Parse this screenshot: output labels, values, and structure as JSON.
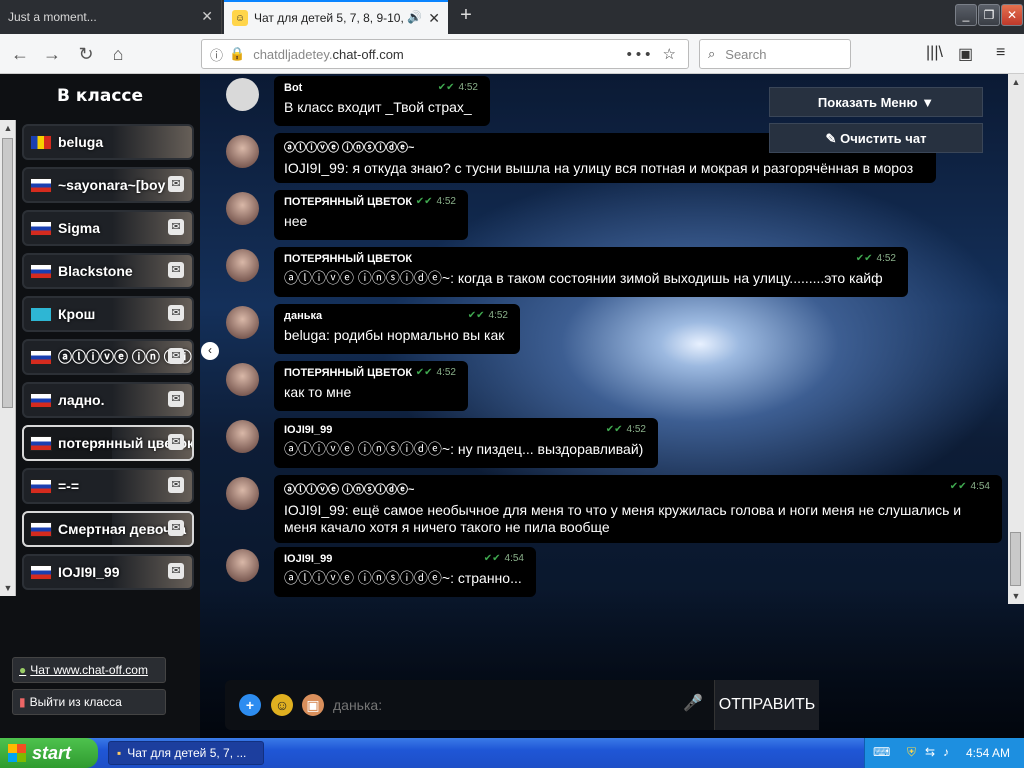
{
  "tabs": [
    {
      "title": "Just a moment..."
    },
    {
      "title": "Чат для детей 5, 7, 8, 9-10,"
    }
  ],
  "navbar": {
    "url_domain_muted": "chatdljadetey.",
    "url_domain_main": "chat-off.com",
    "search_placeholder": "Search",
    "page_actions": "•••"
  },
  "sidebar": {
    "title": "В классе",
    "users": [
      {
        "name": "beluga",
        "flag": "ro",
        "pm": false
      },
      {
        "name": "~sayonara~[boy",
        "flag": "ru",
        "pm": true
      },
      {
        "name": "Sigma",
        "flag": "ru",
        "pm": true
      },
      {
        "name": "Blackstone",
        "flag": "ru",
        "pm": true
      },
      {
        "name": "Крош",
        "flag": "kz",
        "pm": true
      },
      {
        "name": "ⓐⓛⓘⓥⓔ ⓘⓝ ⓢⓘ",
        "flag": "ru",
        "pm": true
      },
      {
        "name": "ладно.",
        "flag": "ru",
        "pm": true
      },
      {
        "name": "потерянный цветок",
        "flag": "ru",
        "pm": true
      },
      {
        "name": "=-=",
        "flag": "ru",
        "pm": true
      },
      {
        "name": "Смертная девочка",
        "flag": "ru",
        "pm": true
      },
      {
        "name": "IOJI9I_99",
        "flag": "ru",
        "pm": true
      }
    ],
    "link_chat": "Чат www.chat-off.com",
    "link_exit": "Выйти из класса"
  },
  "chat": {
    "menu_button": "Показать Меню ▼",
    "clear_button": "Очистить чат",
    "messages": [
      {
        "author": "Bot",
        "time": "4:52",
        "text": "В класс входит _Твой страх_"
      },
      {
        "author": "ⓐⓛⓘⓥⓔ ⓘⓝⓢⓘⓓⓔ~",
        "time": "",
        "text": "IOJI9I_99: я откуда знаю? с тусни вышла на улицу вся потная и мокрая и разгорячённая в мороз"
      },
      {
        "author": "ПОТЕРЯННЫЙ ЦВЕТОК",
        "time": "4:52",
        "text": "нее"
      },
      {
        "author": "ПОТЕРЯННЫЙ ЦВЕТОК",
        "time": "4:52",
        "text": "ⓐⓛⓘⓥⓔ ⓘⓝⓢⓘⓓⓔ~: когда в таком состоянии зимой выходишь на улицу.........это кайф"
      },
      {
        "author": "данька",
        "time": "4:52",
        "text": "beluga: родибы нормально вы как"
      },
      {
        "author": "ПОТЕРЯННЫЙ ЦВЕТОК",
        "time": "4:52",
        "text": "как то мне"
      },
      {
        "author": "IOJI9I_99",
        "time": "4:52",
        "text": "ⓐⓛⓘⓥⓔ ⓘⓝⓢⓘⓓⓔ~: ну пиздец... выздоравливай)"
      },
      {
        "author": "ⓐⓛⓘⓥⓔ ⓘⓝⓢⓘⓓⓔ~",
        "time": "4:54",
        "text": "IOJI9I_99: ещё самое необычное для меня то что у меня кружилась голова и ноги меня не слушались и меня качало хотя я ничего такого не пила вообще"
      },
      {
        "author": "IOJI9I_99",
        "time": "4:54",
        "text": "ⓐⓛⓘⓥⓔ ⓘⓝⓢⓘⓓⓔ~: странно..."
      }
    ]
  },
  "input": {
    "value": "",
    "placeholder": "данька:",
    "send_label": "ОТПРАВИТЬ"
  },
  "taskbar": {
    "start_label": "start",
    "task_title": "Чат для детей 5, 7, ...",
    "clock": "4:54 AM"
  }
}
